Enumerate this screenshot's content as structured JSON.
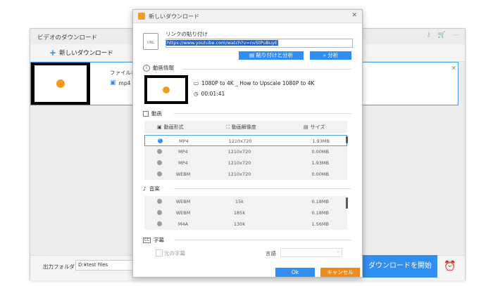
{
  "main_window": {
    "title": "ビデオのダウンロード",
    "new_download_label": "新しいダウンロード",
    "file_name_label": "ファイル名: ",
    "format": "mp4",
    "output_folder_label": "出力フォルダ：",
    "output_folder_value": "D:¥test files",
    "start_download_label": "ダウンロードを開始"
  },
  "dialog": {
    "title": "新しいダウンロード",
    "paste_link_label": "リンクの貼り付け",
    "url": "https://www.youtube.com/watch?v=nvStPuBuyE",
    "paste_analyze_button": "貼り付けと分析",
    "analyze_button": "分析",
    "video_info_label": "動画情報",
    "video_title": "1080P to 4K _ How to Upscale 1080P to 4K",
    "duration": "00:01:41",
    "video_section_label": "動画",
    "video_columns": [
      "動画形式",
      "動画解像度",
      "サイズ"
    ],
    "video_rows": [
      {
        "format": "MP4",
        "resolution": "1210x720",
        "size": "1.93MB",
        "selected": true
      },
      {
        "format": "MP4",
        "resolution": "1210x720",
        "size": "0.00MB",
        "selected": false
      },
      {
        "format": "MP4",
        "resolution": "1210x720",
        "size": "1.93MB",
        "selected": false
      },
      {
        "format": "WEBM",
        "resolution": "1210x720",
        "size": "0.00MB",
        "selected": false
      }
    ],
    "audio_section_label": "音楽",
    "audio_rows": [
      {
        "format": "WEBM",
        "bitrate": "15k",
        "size": "0.18MB"
      },
      {
        "format": "WEBM",
        "bitrate": "185k",
        "size": "0.18MB"
      },
      {
        "format": "M4A",
        "bitrate": "130k",
        "size": "1.56MB"
      }
    ],
    "subtitle_section_label": "字幕",
    "original_subtitle_label": "元の字幕",
    "language_label": "言語",
    "ok_button": "Ok",
    "cancel_button": "キャンセル"
  },
  "colors": {
    "accent_blue": "#2f8ff0",
    "cancel_orange": "#f08a1e",
    "thumbnail_dot": "#f39a24"
  }
}
